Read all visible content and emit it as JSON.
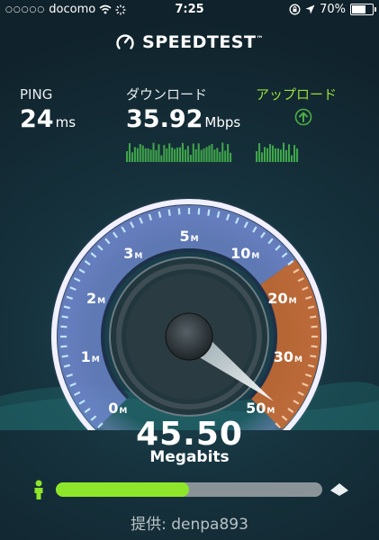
{
  "status_bar": {
    "carrier": "docomo",
    "time": "7:25",
    "battery": "70%",
    "battery_level": 0.7
  },
  "header": {
    "title": "SPEEDTEST",
    "trademark": "™"
  },
  "metrics": {
    "ping": {
      "label": "PING",
      "value": "24",
      "unit": "ms"
    },
    "download": {
      "label": "ダウンロード",
      "value": "35.92",
      "unit": "Mbps"
    },
    "upload": {
      "label": "アップロード"
    }
  },
  "gauge": {
    "ticks": [
      "0",
      "1",
      "2",
      "3",
      "5",
      "10",
      "20",
      "30",
      "50"
    ],
    "tick_unit": "M",
    "current_mbps": 45.5
  },
  "result": {
    "value": "45.50",
    "unit": "Megabits",
    "progress": 0.5
  },
  "footer": {
    "provider": "提供: denpa893"
  },
  "colors": {
    "accent_green": "#8ee62a",
    "upload_label": "#9be03c",
    "arc_blue": "#6b84c8",
    "arc_orange": "#c86a32"
  }
}
